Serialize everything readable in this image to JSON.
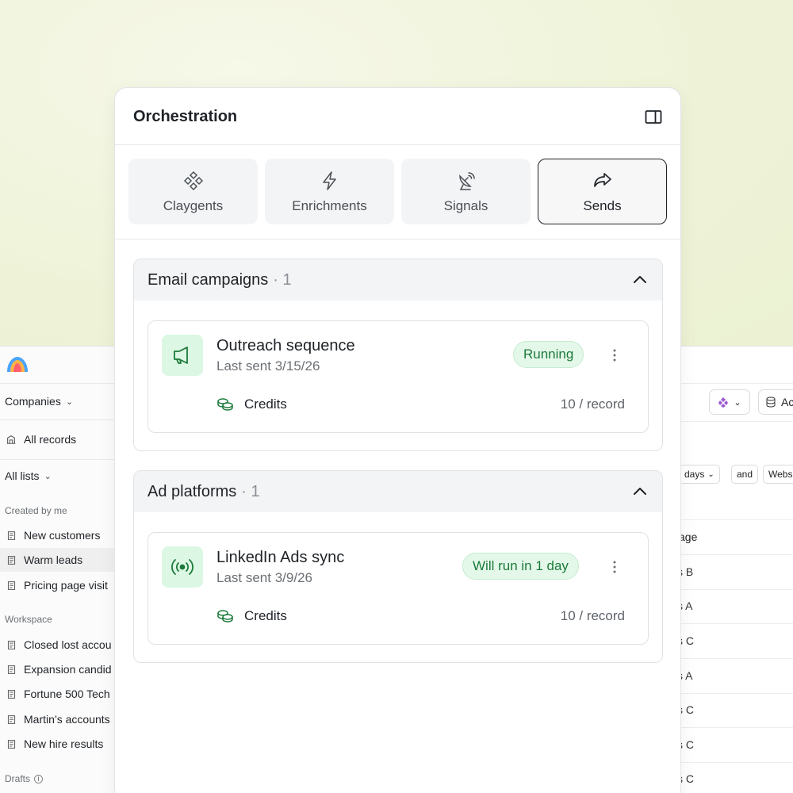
{
  "panel": {
    "title": "Orchestration",
    "tabs": [
      {
        "label": "Claygents",
        "icon": "claygents-icon"
      },
      {
        "label": "Enrichments",
        "icon": "lightning-icon"
      },
      {
        "label": "Signals",
        "icon": "satellite-icon"
      },
      {
        "label": "Sends",
        "icon": "share-arrow-icon",
        "selected": true
      }
    ],
    "sections": [
      {
        "title": "Email campaigns",
        "count": "· 1",
        "items": [
          {
            "name": "Outreach sequence",
            "last_sent": "Last sent 3/15/26",
            "status": "Running",
            "icon": "megaphone-icon",
            "credits_label": "Credits",
            "credits_value": "10 / record"
          }
        ]
      },
      {
        "title": "Ad platforms",
        "count": "· 1",
        "items": [
          {
            "name": "LinkedIn Ads sync",
            "last_sent": "Last sent 3/9/26",
            "status": "Will run in 1 day",
            "icon": "broadcast-icon",
            "credits_label": "Credits",
            "credits_value": "10 / record"
          }
        ]
      }
    ]
  },
  "sidebar": {
    "object_selector": "Companies",
    "all_records": "All records",
    "all_lists": "All lists",
    "created_by_me_label": "Created by me",
    "created_by_me": [
      "New customers",
      "Warm leads",
      "Pricing page visit"
    ],
    "workspace_label": "Workspace",
    "workspace": [
      "Closed lost accou",
      "Expansion candid",
      "Fortune 500 Tech",
      "Martin’s accounts",
      "New hire results"
    ],
    "drafts_label": "Drafts"
  },
  "main": {
    "toolbar_button_label": "Ac",
    "filters": [
      "days",
      "and",
      "Webs"
    ],
    "column_header": "age",
    "cells": [
      "s B",
      "s A",
      "s C",
      "s A",
      "s C",
      "s C",
      "s C"
    ]
  },
  "colors": {
    "accent_green": "#1c7a3a",
    "badge_bg": "#e4f8ea",
    "background": "#f3f6e2"
  }
}
